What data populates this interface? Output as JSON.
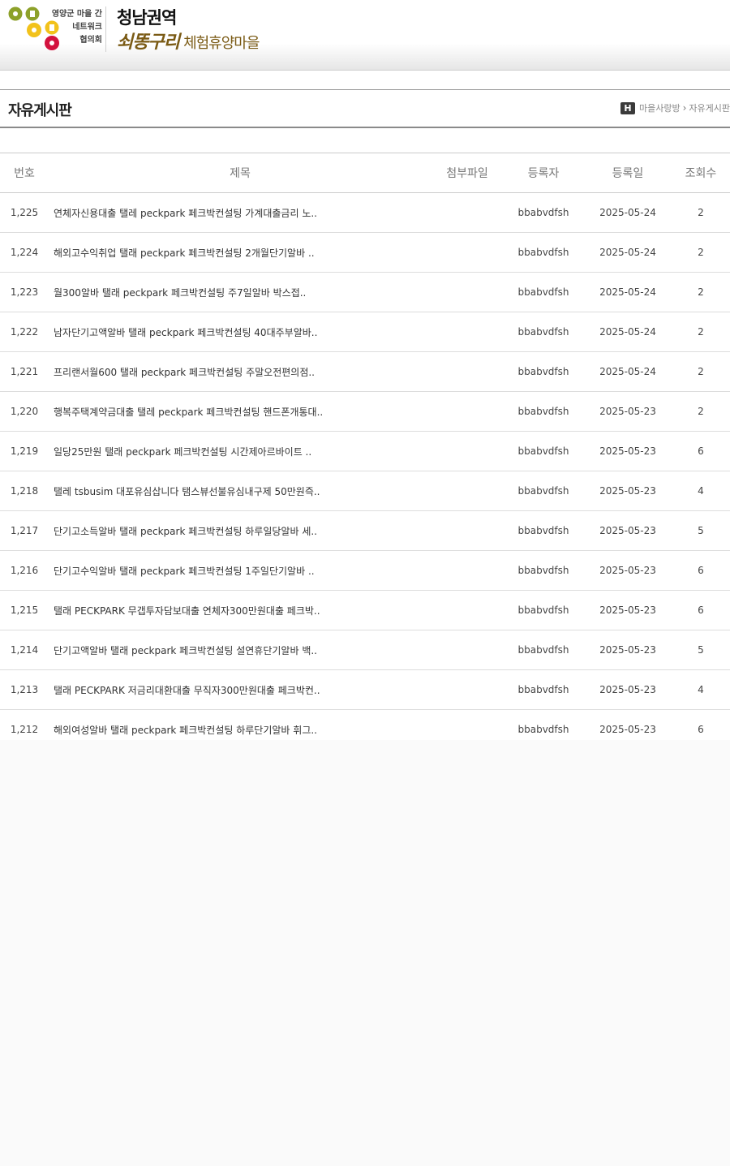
{
  "header": {
    "assoc_lines": [
      "영양군 마을 간",
      "네트워크",
      "협의회"
    ],
    "title_line1": "청남권역",
    "title_line2_highlight": "쇠똥구리",
    "title_line2_rest": "체험휴양마을",
    "colors": {
      "olive": "#8da12a",
      "yellow": "#f2c21b",
      "red": "#d3123e",
      "brown": "#7a5a14"
    }
  },
  "board": {
    "title": "자유게시판",
    "breadcrumb": {
      "home_icon": "H",
      "section": "마을사랑방",
      "current": "자유게시판"
    },
    "columns": [
      "번호",
      "제목",
      "첨부파일",
      "등록자",
      "등록일",
      "조회수"
    ],
    "rows": [
      {
        "no": "1,225",
        "subject": "연체자신용대출 탤레 peckpark 페크박컨설팅 가계대출금리 노..",
        "file": "",
        "writer": "bbabvdfsh",
        "date": "2025-05-24",
        "hits": "2"
      },
      {
        "no": "1,224",
        "subject": "해외고수익취업 탤래 peckpark 페크박컨설팅 2개월단기알바 ..",
        "file": "",
        "writer": "bbabvdfsh",
        "date": "2025-05-24",
        "hits": "2"
      },
      {
        "no": "1,223",
        "subject": "월300알바 탤래 peckpark 페크박컨설팅 주7일알바 박스접..",
        "file": "",
        "writer": "bbabvdfsh",
        "date": "2025-05-24",
        "hits": "2"
      },
      {
        "no": "1,222",
        "subject": "남자단기고액알바 탤래 peckpark 페크박컨설팅 40대주부알바..",
        "file": "",
        "writer": "bbabvdfsh",
        "date": "2025-05-24",
        "hits": "2"
      },
      {
        "no": "1,221",
        "subject": "프리랜서월600 탤래 peckpark 페크박컨설팅 주말오전편의점..",
        "file": "",
        "writer": "bbabvdfsh",
        "date": "2025-05-24",
        "hits": "2"
      },
      {
        "no": "1,220",
        "subject": "행복주택계약금대출 탤레 peckpark 페크박컨설팅 핸드폰개통대..",
        "file": "",
        "writer": "bbabvdfsh",
        "date": "2025-05-23",
        "hits": "2"
      },
      {
        "no": "1,219",
        "subject": "일당25만원 탤래 peckpark 페크박컨설팅 시간제아르바이트 ..",
        "file": "",
        "writer": "bbabvdfsh",
        "date": "2025-05-23",
        "hits": "6"
      },
      {
        "no": "1,218",
        "subject": "탤레 tsbusim 대포유심삽니다 탬스뷰선불유심내구제 50만원즉..",
        "file": "",
        "writer": "bbabvdfsh",
        "date": "2025-05-23",
        "hits": "4"
      },
      {
        "no": "1,217",
        "subject": "단기고소득알바 탤래 peckpark 페크박컨설팅 하루일당알바 세..",
        "file": "",
        "writer": "bbabvdfsh",
        "date": "2025-05-23",
        "hits": "5"
      },
      {
        "no": "1,216",
        "subject": "단기고수익알바 탤래 peckpark 페크박컨설팅 1주일단기알바 ..",
        "file": "",
        "writer": "bbabvdfsh",
        "date": "2025-05-23",
        "hits": "6"
      },
      {
        "no": "1,215",
        "subject": "탤래 PECKPARK 무갭투자담보대출 연체자300만원대출 페크박..",
        "file": "",
        "writer": "bbabvdfsh",
        "date": "2025-05-23",
        "hits": "6"
      },
      {
        "no": "1,214",
        "subject": "단기고액알바 탤래 peckpark 페크박컨설팅 설연휴단기알바 백..",
        "file": "",
        "writer": "bbabvdfsh",
        "date": "2025-05-23",
        "hits": "5"
      },
      {
        "no": "1,213",
        "subject": "탤래 PECKPARK 저금리대환대출 무직자300만원대출 페크박컨..",
        "file": "",
        "writer": "bbabvdfsh",
        "date": "2025-05-23",
        "hits": "4"
      },
      {
        "no": "1,212",
        "subject": "해외여성알바 탤래 peckpark 페크박컨설팅 하루단기알바 휘그..",
        "file": "",
        "writer": "bbabvdfsh",
        "date": "2025-05-23",
        "hits": "6"
      }
    ]
  }
}
